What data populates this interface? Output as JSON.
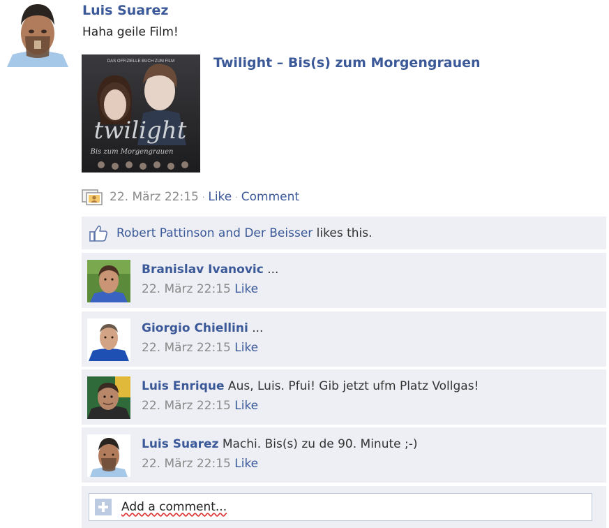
{
  "post": {
    "author": "Luis Suarez",
    "text": "Haha geile Film!",
    "attachment": {
      "title": "Twilight – Bis(s) zum Morgengrauen",
      "cover_header": "DAS OFFIZIELLE BUCH ZUM FILM",
      "cover_title": "twilight",
      "cover_subtitle": "Bis zum Morgengrauen"
    },
    "meta": {
      "timestamp": "22. März 22:15",
      "separator": "·",
      "like_label": "Like",
      "comment_label": "Comment"
    }
  },
  "likes": {
    "names": "Robert Pattinson and Der Beisser",
    "suffix": " likes this."
  },
  "comments": [
    {
      "name": "Branislav Ivanovic",
      "text": " ...",
      "time": "22. März 22:15",
      "like": "Like"
    },
    {
      "name": "Giorgio Chiellini",
      "text": " ...",
      "time": "22. März 22:15",
      "like": "Like"
    },
    {
      "name": "Luis Enrique",
      "text": " Aus, Luis. Pfui! Gib jetzt ufm Platz Vollgas!",
      "time": "22. März 22:15",
      "like": "Like"
    },
    {
      "name": "Luis Suarez",
      "text": " Machi. Bis(s) zu de 90. Minute ;-)",
      "time": "22. März 22:15",
      "like": "Like"
    }
  ],
  "add_comment": {
    "placeholder": "Add a comment..."
  },
  "colors": {
    "link": "#3b5998",
    "ufi_bg": "#edeff4",
    "meta": "#8a8a8a"
  },
  "icons": [
    "photo-stack-icon",
    "thumbs-up-icon",
    "plus-icon"
  ]
}
